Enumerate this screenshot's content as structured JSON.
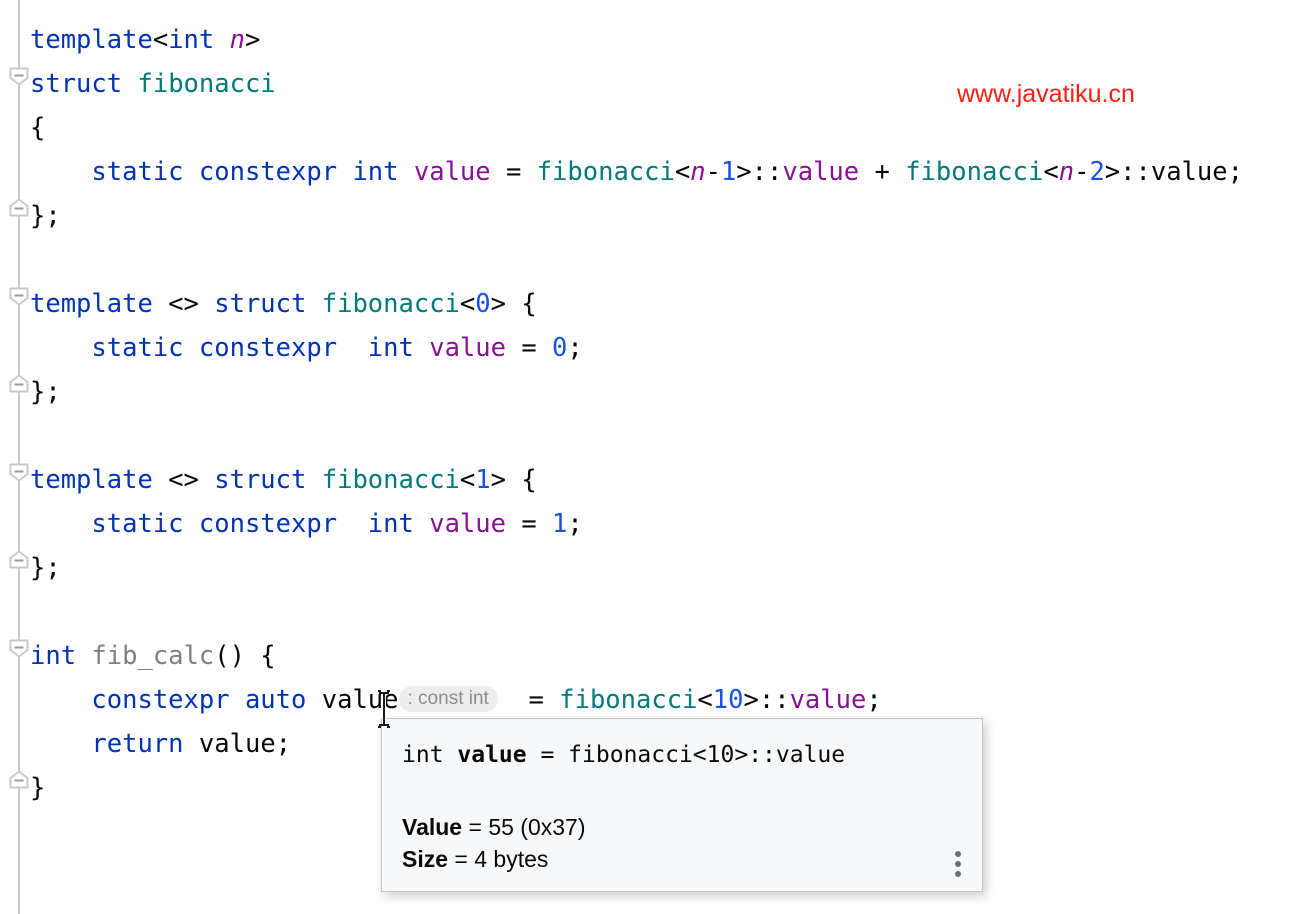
{
  "editor": {
    "language": "C++",
    "background_color": "#ffffff",
    "gutter_line_color": "#c9c9c9",
    "syntax_colors": {
      "keyword": "#0033b3",
      "type_name": "#007a7a",
      "number": "#1750eb",
      "field": "#871094",
      "template_parameter": "#871094",
      "function_declaration": "#808080",
      "plain_text": "#080808",
      "inline_hint_background": "#ededed",
      "inline_hint_text": "#8c8c8c"
    },
    "lines": [
      {
        "number": 1,
        "fold": "none",
        "tokens": [
          {
            "t": "template",
            "c": "kw"
          },
          {
            "t": "<",
            "c": "txt"
          },
          {
            "t": "int",
            "c": "kw"
          },
          {
            "t": " ",
            "c": "txt"
          },
          {
            "t": "n",
            "c": "tpar"
          },
          {
            "t": ">",
            "c": "txt"
          }
        ]
      },
      {
        "number": 2,
        "fold": "open",
        "tokens": [
          {
            "t": "struct",
            "c": "kw"
          },
          {
            "t": " ",
            "c": "txt"
          },
          {
            "t": "fibonacci",
            "c": "type"
          }
        ]
      },
      {
        "number": 3,
        "fold": "none",
        "tokens": [
          {
            "t": "{",
            "c": "txt"
          }
        ]
      },
      {
        "number": 4,
        "fold": "none",
        "tokens": [
          {
            "t": "    ",
            "c": "txt"
          },
          {
            "t": "static",
            "c": "kw"
          },
          {
            "t": " ",
            "c": "txt"
          },
          {
            "t": "constexpr",
            "c": "kw"
          },
          {
            "t": " ",
            "c": "txt"
          },
          {
            "t": "int",
            "c": "kw"
          },
          {
            "t": " ",
            "c": "txt"
          },
          {
            "t": "value",
            "c": "fld"
          },
          {
            "t": " = ",
            "c": "txt"
          },
          {
            "t": "fibonacci",
            "c": "type"
          },
          {
            "t": "<",
            "c": "txt"
          },
          {
            "t": "n",
            "c": "tpar"
          },
          {
            "t": "-",
            "c": "txt"
          },
          {
            "t": "1",
            "c": "num"
          },
          {
            "t": ">::",
            "c": "txt"
          },
          {
            "t": "value",
            "c": "fld"
          },
          {
            "t": " + ",
            "c": "txt"
          },
          {
            "t": "fibonacci",
            "c": "type"
          },
          {
            "t": "<",
            "c": "txt"
          },
          {
            "t": "n",
            "c": "tpar"
          },
          {
            "t": "-",
            "c": "txt"
          },
          {
            "t": "2",
            "c": "num"
          },
          {
            "t": ">::value;",
            "c": "txt"
          }
        ]
      },
      {
        "number": 5,
        "fold": "close",
        "tokens": [
          {
            "t": "};",
            "c": "txt"
          }
        ]
      },
      {
        "number": 6,
        "fold": "none",
        "tokens": []
      },
      {
        "number": 7,
        "fold": "open",
        "tokens": [
          {
            "t": "template",
            "c": "kw"
          },
          {
            "t": " <> ",
            "c": "txt"
          },
          {
            "t": "struct",
            "c": "kw"
          },
          {
            "t": " ",
            "c": "txt"
          },
          {
            "t": "fibonacci",
            "c": "type"
          },
          {
            "t": "<",
            "c": "txt"
          },
          {
            "t": "0",
            "c": "num"
          },
          {
            "t": "> {",
            "c": "txt"
          }
        ]
      },
      {
        "number": 8,
        "fold": "none",
        "tokens": [
          {
            "t": "    ",
            "c": "txt"
          },
          {
            "t": "static",
            "c": "kw"
          },
          {
            "t": " ",
            "c": "txt"
          },
          {
            "t": "constexpr",
            "c": "kw"
          },
          {
            "t": "  ",
            "c": "txt"
          },
          {
            "t": "int",
            "c": "kw"
          },
          {
            "t": " ",
            "c": "txt"
          },
          {
            "t": "value",
            "c": "fld"
          },
          {
            "t": " = ",
            "c": "txt"
          },
          {
            "t": "0",
            "c": "num"
          },
          {
            "t": ";",
            "c": "txt"
          }
        ]
      },
      {
        "number": 9,
        "fold": "close",
        "tokens": [
          {
            "t": "};",
            "c": "txt"
          }
        ]
      },
      {
        "number": 10,
        "fold": "none",
        "tokens": []
      },
      {
        "number": 11,
        "fold": "open",
        "tokens": [
          {
            "t": "template",
            "c": "kw"
          },
          {
            "t": " <> ",
            "c": "txt"
          },
          {
            "t": "struct",
            "c": "kw"
          },
          {
            "t": " ",
            "c": "txt"
          },
          {
            "t": "fibonacci",
            "c": "type"
          },
          {
            "t": "<",
            "c": "txt"
          },
          {
            "t": "1",
            "c": "num"
          },
          {
            "t": "> {",
            "c": "txt"
          }
        ]
      },
      {
        "number": 12,
        "fold": "none",
        "tokens": [
          {
            "t": "    ",
            "c": "txt"
          },
          {
            "t": "static",
            "c": "kw"
          },
          {
            "t": " ",
            "c": "txt"
          },
          {
            "t": "constexpr",
            "c": "kw"
          },
          {
            "t": "  ",
            "c": "txt"
          },
          {
            "t": "int",
            "c": "kw"
          },
          {
            "t": " ",
            "c": "txt"
          },
          {
            "t": "value",
            "c": "fld"
          },
          {
            "t": " = ",
            "c": "txt"
          },
          {
            "t": "1",
            "c": "num"
          },
          {
            "t": ";",
            "c": "txt"
          }
        ]
      },
      {
        "number": 13,
        "fold": "close",
        "tokens": [
          {
            "t": "};",
            "c": "txt"
          }
        ]
      },
      {
        "number": 14,
        "fold": "none",
        "tokens": []
      },
      {
        "number": 15,
        "fold": "open",
        "tokens": [
          {
            "t": "int",
            "c": "kw"
          },
          {
            "t": " ",
            "c": "txt"
          },
          {
            "t": "fib_calc",
            "c": "fn"
          },
          {
            "t": "() {",
            "c": "txt"
          }
        ]
      },
      {
        "number": 16,
        "fold": "none",
        "tokens": [
          {
            "t": "    ",
            "c": "txt"
          },
          {
            "t": "constexpr",
            "c": "kw"
          },
          {
            "t": " ",
            "c": "txt"
          },
          {
            "t": "auto",
            "c": "kw"
          },
          {
            "t": " ",
            "c": "txt"
          },
          {
            "t": "value",
            "c": "txt"
          },
          {
            "t": ": const int",
            "c": "hint"
          },
          {
            "t": "  = ",
            "c": "txt"
          },
          {
            "t": "fibonacci",
            "c": "type"
          },
          {
            "t": "<",
            "c": "txt"
          },
          {
            "t": "10",
            "c": "num"
          },
          {
            "t": ">::",
            "c": "txt"
          },
          {
            "t": "value",
            "c": "fld"
          },
          {
            "t": ";",
            "c": "txt"
          }
        ]
      },
      {
        "number": 17,
        "fold": "none",
        "tokens": [
          {
            "t": "    ",
            "c": "txt"
          },
          {
            "t": "return",
            "c": "kw"
          },
          {
            "t": " ",
            "c": "txt"
          },
          {
            "t": "value;",
            "c": "txt"
          }
        ]
      },
      {
        "number": 18,
        "fold": "close",
        "tokens": [
          {
            "t": "}",
            "c": "txt"
          }
        ]
      }
    ]
  },
  "watermark": {
    "text": "www.javatiku.cn",
    "color": "#fd1d13"
  },
  "tooltip": {
    "signature_prefix": "int ",
    "signature_name": "value",
    "signature_suffix": " = fibonacci<10>::value",
    "rows": [
      {
        "label": "Value",
        "separator": " = ",
        "value": "55 (0x37)"
      },
      {
        "label": "Size",
        "separator": " = ",
        "value": "4 bytes"
      }
    ],
    "menu_label": "more-options"
  }
}
